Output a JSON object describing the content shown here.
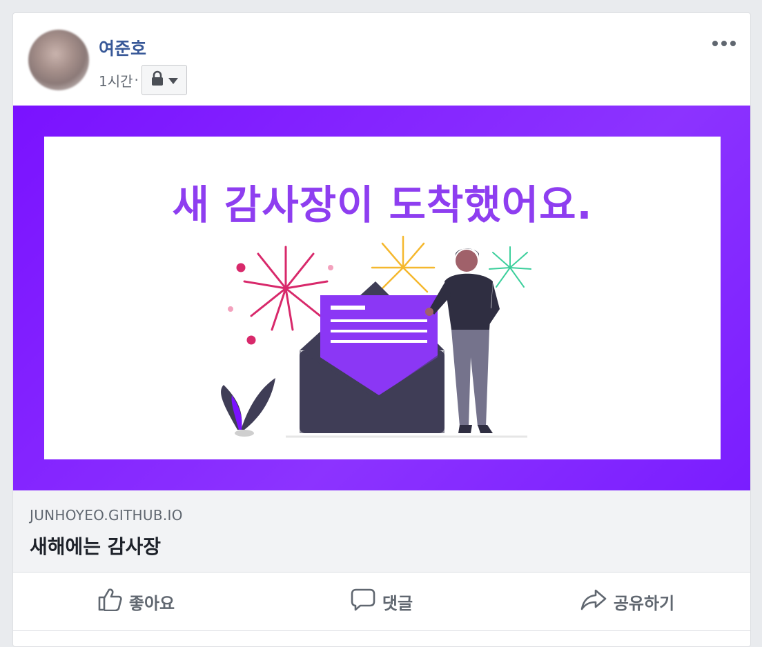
{
  "post": {
    "author": "여준호",
    "time": "1시간",
    "separator": "·",
    "privacy_icon": "lock-icon"
  },
  "link": {
    "banner_text": "새 감사장이 도착했어요.",
    "domain": "JUNHOYEO.GITHUB.IO",
    "title": "새해에는 감사장"
  },
  "actions": {
    "like": "좋아요",
    "comment": "댓글",
    "share": "공유하기"
  },
  "colors": {
    "author": "#385898",
    "banner_bg": "#7a12ff",
    "banner_text": "#8e3ef0"
  }
}
